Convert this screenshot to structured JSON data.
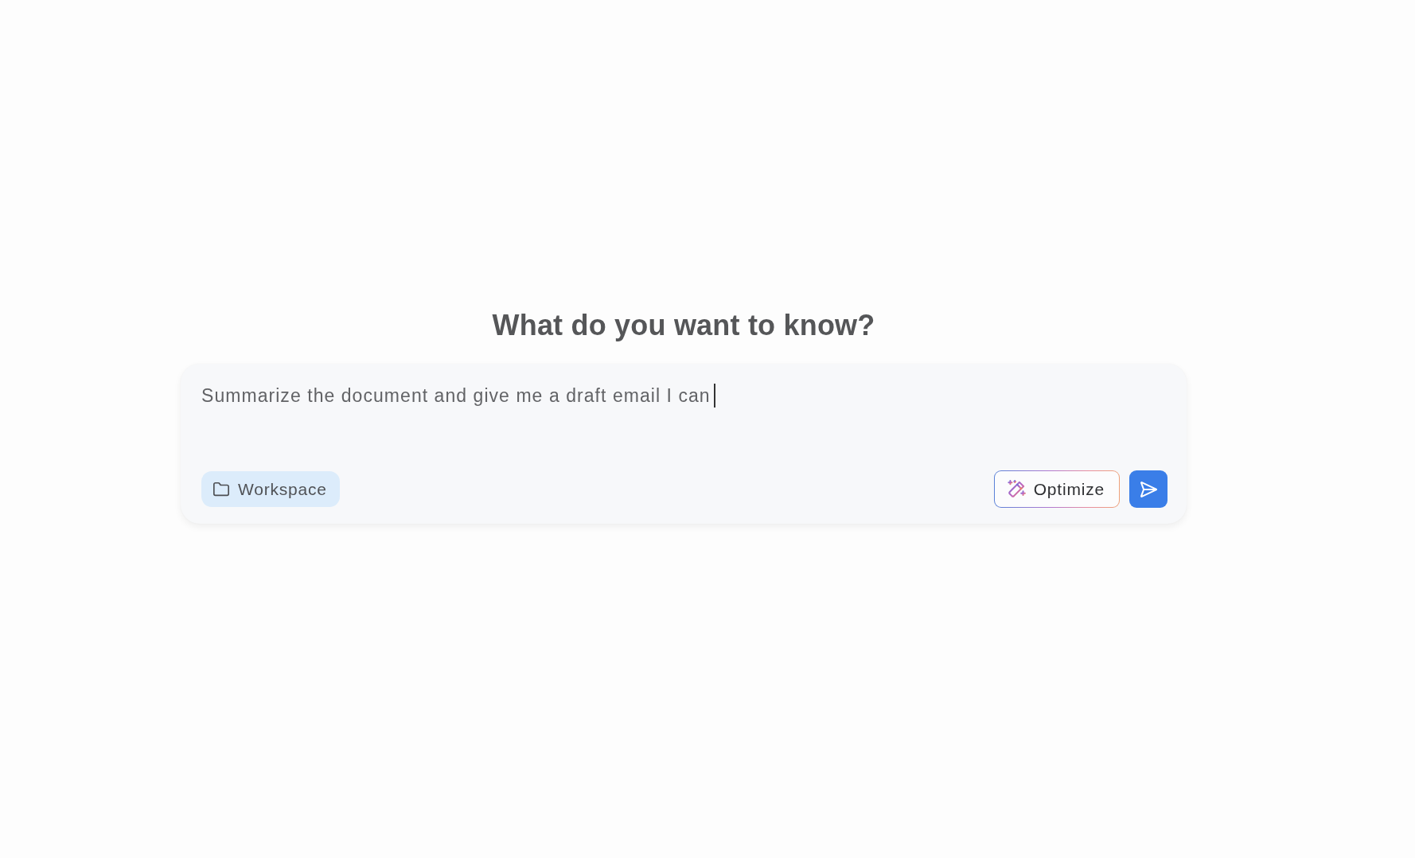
{
  "heading": "What do you want to know?",
  "prompt": {
    "value": "Summarize the document and give me a draft email I can",
    "focused": true
  },
  "workspace_button": {
    "label": "Workspace"
  },
  "optimize_button": {
    "label": "Optimize"
  },
  "send_button": {
    "disabled": false
  }
}
